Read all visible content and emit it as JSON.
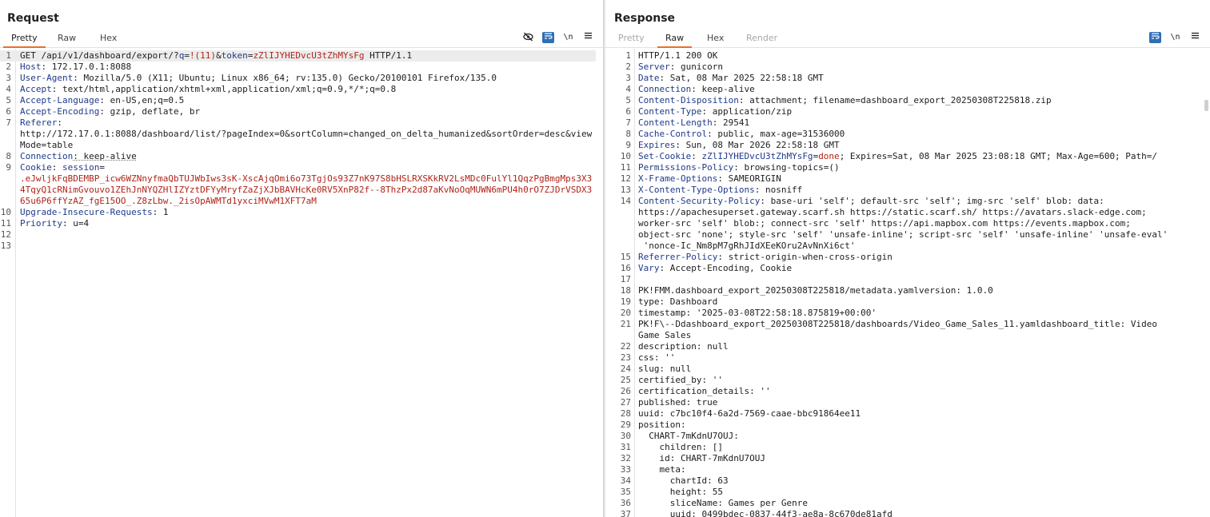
{
  "layout_buttons": [
    "split-vertical",
    "split-horizontal",
    "single-tab"
  ],
  "request": {
    "title": "Request",
    "tabs": [
      "Pretty",
      "Raw",
      "Hex"
    ],
    "toolbar": [
      "eye-off-icon",
      "wrap-icon",
      "newline-icon",
      "menu-icon"
    ],
    "lines": [
      {
        "n": "1",
        "parts": [
          [
            "GET /api/v1/dashboard/export/?",
            "hv"
          ],
          [
            "q",
            "hn"
          ],
          [
            "=",
            "hv"
          ],
          [
            "!(11)",
            "red"
          ],
          [
            "&",
            "hv"
          ],
          [
            "token",
            "hn"
          ],
          [
            "=",
            "hv"
          ],
          [
            "zZlIJYHEDvcU3tZhMYsFg",
            "red"
          ],
          [
            " HTTP/1.1",
            "hv"
          ]
        ]
      },
      {
        "n": "2",
        "parts": [
          [
            "Host",
            "hn"
          ],
          [
            ": 172.17.0.1:8088",
            "hv"
          ]
        ]
      },
      {
        "n": "3",
        "parts": [
          [
            "User-Agent",
            "hn"
          ],
          [
            ": Mozilla/5.0 (X11; Ubuntu; Linux x86_64; rv:135.0) Gecko/20100101 Firefox/135.0",
            "hv"
          ]
        ]
      },
      {
        "n": "4",
        "parts": [
          [
            "Accept",
            "hn"
          ],
          [
            ": text/html,application/xhtml+xml,application/xml;q=0.9,*/*;q=0.8",
            "hv"
          ]
        ]
      },
      {
        "n": "5",
        "parts": [
          [
            "Accept-Language",
            "hn"
          ],
          [
            ": en-US,en;q=0.5",
            "hv"
          ]
        ]
      },
      {
        "n": "6",
        "parts": [
          [
            "Accept-Encoding",
            "hn"
          ],
          [
            ": gzip, deflate, br",
            "hv"
          ]
        ]
      },
      {
        "n": "7",
        "parts": [
          [
            "Referer",
            "hn"
          ],
          [
            ":\nhttp://172.17.0.1:8088/dashboard/list/?pageIndex=0&sortColumn=changed_on_delta_humanized&sortOrder=desc&viewMode=table",
            "hv"
          ]
        ]
      },
      {
        "n": "8",
        "parts": [
          [
            "Connection",
            "hn"
          ],
          [
            ": keep-alive",
            "hv ul"
          ]
        ]
      },
      {
        "n": "9",
        "parts": [
          [
            "Cookie",
            "hn"
          ],
          [
            ": ",
            "hv"
          ],
          [
            "session",
            "hn"
          ],
          [
            "=\n",
            "hv"
          ],
          [
            ".eJwljkFqBDEMBP_icw6WZNnyfmaQbTUJWbIws3sK-XscAjqOmi6o73TgjOs93Z7nK97S8bHSLRXSKkRV2LsMDc0FulYl1QqzPgBmgMps3X34TqyQ1cRNimGvouvo1ZEhJnNYQZHlIZYztDFYyMryfZaZjXJbBAVHcKe0RV5XnP82f--8ThzPx2d87aKvNoOqMUWN6mPU4h0rO7ZJDrVSDX365u6P6ffYzAZ_fgE15OO_.Z8zLbw._2isOpAWMTd1yxciMVwM1XFT7aM",
            "red"
          ]
        ]
      },
      {
        "n": "10",
        "parts": [
          [
            "Upgrade-Insecure-Requests",
            "hn"
          ],
          [
            ": 1",
            "hv"
          ]
        ]
      },
      {
        "n": "11",
        "parts": [
          [
            "Priority",
            "hn"
          ],
          [
            ": u=4",
            "hv"
          ]
        ]
      },
      {
        "n": "12",
        "parts": [
          [
            "",
            "hv"
          ]
        ]
      },
      {
        "n": "13",
        "parts": [
          [
            "",
            "hv"
          ]
        ]
      }
    ]
  },
  "response": {
    "title": "Response",
    "tabs": [
      "Pretty",
      "Raw",
      "Hex",
      "Render"
    ],
    "toolbar": [
      "wrap-icon",
      "newline-icon",
      "menu-icon"
    ],
    "lines": [
      {
        "n": "1",
        "parts": [
          [
            "HTTP/1.1 200 OK",
            "hv"
          ]
        ]
      },
      {
        "n": "2",
        "parts": [
          [
            "Server",
            "hn"
          ],
          [
            ": gunicorn",
            "hv"
          ]
        ]
      },
      {
        "n": "3",
        "parts": [
          [
            "Date",
            "hn"
          ],
          [
            ": Sat, 08 Mar 2025 22:58:18 GMT",
            "hv"
          ]
        ]
      },
      {
        "n": "4",
        "parts": [
          [
            "Connection",
            "hn"
          ],
          [
            ": keep-alive",
            "hv"
          ]
        ]
      },
      {
        "n": "5",
        "parts": [
          [
            "Content-Disposition",
            "hn"
          ],
          [
            ": attachment; filename=dashboard_export_20250308T225818.zip",
            "hv"
          ]
        ]
      },
      {
        "n": "6",
        "parts": [
          [
            "Content-Type",
            "hn"
          ],
          [
            ": application/zip",
            "hv"
          ]
        ]
      },
      {
        "n": "7",
        "parts": [
          [
            "Content-Length",
            "hn"
          ],
          [
            ": 29541",
            "hv"
          ]
        ]
      },
      {
        "n": "8",
        "parts": [
          [
            "Cache-Control",
            "hn"
          ],
          [
            ": public, max-age=31536000",
            "hv"
          ]
        ]
      },
      {
        "n": "9",
        "parts": [
          [
            "Expires",
            "hn"
          ],
          [
            ": Sun, 08 Mar 2026 22:58:18 GMT",
            "hv"
          ]
        ]
      },
      {
        "n": "10",
        "parts": [
          [
            "Set-Cookie",
            "hn"
          ],
          [
            ": ",
            "hv"
          ],
          [
            "zZlIJYHEDvcU3tZhMYsFg",
            "hn"
          ],
          [
            "=",
            "hv"
          ],
          [
            "done",
            "red"
          ],
          [
            "; Expires=Sat, 08 Mar 2025 23:08:18 GMT; Max-Age=600; Path=/",
            "hv"
          ]
        ]
      },
      {
        "n": "11",
        "parts": [
          [
            "Permissions-Policy",
            "hn"
          ],
          [
            ": browsing-topics=()",
            "hv"
          ]
        ]
      },
      {
        "n": "12",
        "parts": [
          [
            "X-Frame-Options",
            "hn"
          ],
          [
            ": SAMEORIGIN",
            "hv"
          ]
        ]
      },
      {
        "n": "13",
        "parts": [
          [
            "X-Content-Type-Options",
            "hn"
          ],
          [
            ": nosniff",
            "hv"
          ]
        ]
      },
      {
        "n": "14",
        "parts": [
          [
            "Content-Security-Policy",
            "hn"
          ],
          [
            ": base-uri 'self'; default-src 'self'; img-src 'self' blob: data:\nhttps://apachesuperset.gateway.scarf.sh https://static.scarf.sh/ https://avatars.slack-edge.com;\nworker-src 'self' blob:; connect-src 'self' https://api.mapbox.com https://events.mapbox.com;\nobject-src 'none'; style-src 'self' 'unsafe-inline'; script-src 'self' 'unsafe-inline' 'unsafe-eval'\n 'nonce-Ic_Nm8pM7gRhJIdXEeKOru2AvNnXi6ct'",
            "hv"
          ]
        ]
      },
      {
        "n": "15",
        "parts": [
          [
            "Referrer-Policy",
            "hn"
          ],
          [
            ": strict-origin-when-cross-origin",
            "hv"
          ]
        ]
      },
      {
        "n": "16",
        "parts": [
          [
            "Vary",
            "hn"
          ],
          [
            ": Accept-Encoding, Cookie",
            "hv"
          ]
        ]
      },
      {
        "n": "17",
        "parts": [
          [
            "",
            "hv"
          ]
        ]
      },
      {
        "n": "18",
        "parts": [
          [
            "PK!FMM.dashboard_export_20250308T225818/metadata.yamlversion: 1.0.0",
            "hv"
          ]
        ]
      },
      {
        "n": "19",
        "parts": [
          [
            "type: Dashboard",
            "hv"
          ]
        ]
      },
      {
        "n": "20",
        "parts": [
          [
            "timestamp: '2025-03-08T22:58:18.875819+00:00'",
            "hv"
          ]
        ]
      },
      {
        "n": "21",
        "parts": [
          [
            "PK!F\\--Ddashboard_export_20250308T225818/dashboards/Video_Game_Sales_11.yamldashboard_title: Video\nGame Sales",
            "hv"
          ]
        ]
      },
      {
        "n": "22",
        "parts": [
          [
            "description: null",
            "hv"
          ]
        ]
      },
      {
        "n": "23",
        "parts": [
          [
            "css: ''",
            "hv"
          ]
        ]
      },
      {
        "n": "24",
        "parts": [
          [
            "slug: null",
            "hv"
          ]
        ]
      },
      {
        "n": "25",
        "parts": [
          [
            "certified_by: ''",
            "hv"
          ]
        ]
      },
      {
        "n": "26",
        "parts": [
          [
            "certification_details: ''",
            "hv"
          ]
        ]
      },
      {
        "n": "27",
        "parts": [
          [
            "published: true",
            "hv"
          ]
        ]
      },
      {
        "n": "28",
        "parts": [
          [
            "uuid: c7bc10f4-6a2d-7569-caae-bbc91864ee11",
            "hv"
          ]
        ]
      },
      {
        "n": "29",
        "parts": [
          [
            "position:",
            "hv"
          ]
        ]
      },
      {
        "n": "30",
        "parts": [
          [
            "  CHART-7mKdnU7OUJ:",
            "hv"
          ]
        ]
      },
      {
        "n": "31",
        "parts": [
          [
            "    children: []",
            "hv"
          ]
        ]
      },
      {
        "n": "32",
        "parts": [
          [
            "    id: CHART-7mKdnU7OUJ",
            "hv"
          ]
        ]
      },
      {
        "n": "33",
        "parts": [
          [
            "    meta:",
            "hv"
          ]
        ]
      },
      {
        "n": "34",
        "parts": [
          [
            "      chartId: 63",
            "hv"
          ]
        ]
      },
      {
        "n": "35",
        "parts": [
          [
            "      height: 55",
            "hv"
          ]
        ]
      },
      {
        "n": "36",
        "parts": [
          [
            "      sliceName: Games per Genre",
            "hv"
          ]
        ]
      },
      {
        "n": "37",
        "parts": [
          [
            "      uuid: 0499bdec-0837-44f3-ae8a-8c670de81afd",
            "hv"
          ]
        ]
      }
    ]
  }
}
